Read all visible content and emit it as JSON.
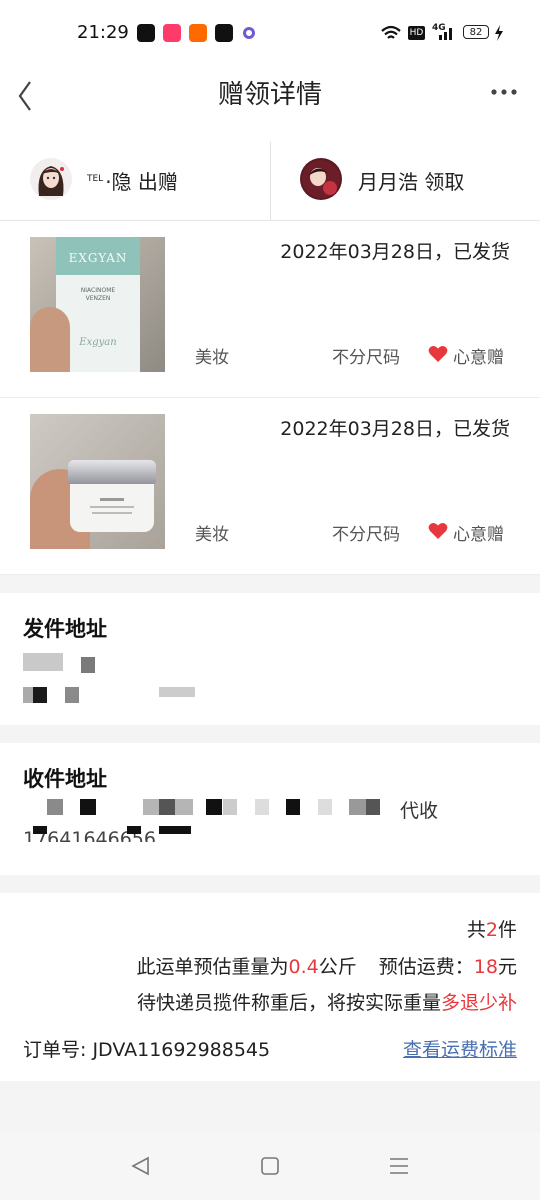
{
  "status_bar": {
    "time": "21:29",
    "apps": [
      {
        "icon": "tiktok-icon",
        "color": "#111111"
      },
      {
        "icon": "kuaishou-icon",
        "color": "#ff3b6b"
      },
      {
        "icon": "taobao-icon",
        "color": "#ff6a00"
      },
      {
        "icon": "capcut-icon",
        "color": "#111111"
      },
      {
        "icon": "ring-app-icon",
        "color": "#6b5bd6"
      }
    ],
    "signal_icons": [
      "wifi-icon",
      "hd-icon",
      "4g-signal-icon"
    ],
    "hd_label": "HD",
    "network_label": "4G",
    "battery_level": "82"
  },
  "header": {
    "title": "赠领详情",
    "back_icon": "chevron-left-icon",
    "more_icon": "more-horizontal-icon"
  },
  "people": {
    "giver": {
      "tel_prefix": "TEL",
      "name": "·隐",
      "action": "出赠"
    },
    "receiver": {
      "name": "月月浩",
      "action": "领取"
    }
  },
  "items": [
    {
      "date": "2022年03月28日，已发货",
      "category": "美妆",
      "size": "不分尺码",
      "type": "心意赠",
      "photo_brand": "EXGYAN",
      "photo_line1": "NIACINOME",
      "photo_line2": "VENZEN",
      "photo_script": "Exgyan"
    },
    {
      "date": "2022年03月28日，已发货",
      "category": "美妆",
      "size": "不分尺码",
      "type": "心意赠",
      "photo_brand": "",
      "photo_line1": "",
      "photo_line2": "",
      "photo_script": ""
    }
  ],
  "sender_address": {
    "title": "发件地址"
  },
  "receiver_address": {
    "title": "收件地址",
    "partial_text": "代收",
    "phone_fragment": "17641646656"
  },
  "fee": {
    "count_prefix": "共",
    "count": "2",
    "count_suffix": "件",
    "weight_prefix": "此运单预估重量为",
    "weight": "0.4",
    "weight_unit": "公斤",
    "cost_label": "预估运费：",
    "cost": "18",
    "cost_unit": "元",
    "note_prefix": "待快递员揽件称重后，将按实际重量",
    "note_highlight": "多退少补",
    "order_label": "订单号:",
    "order_number": "JDVA11692988545",
    "link": "查看运费标准"
  },
  "accent_color": "#e8383d",
  "link_color": "#4a6fb3"
}
